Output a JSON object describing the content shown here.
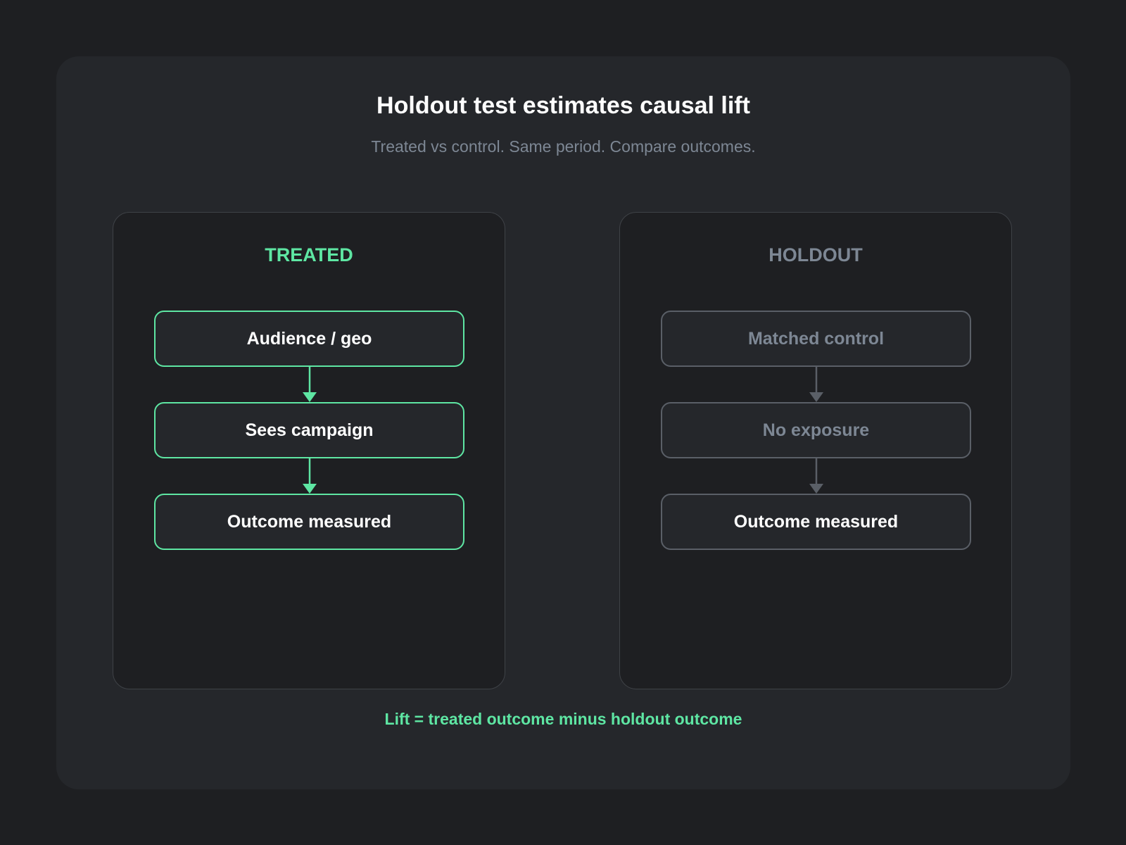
{
  "title": "Holdout test estimates causal lift",
  "subtitle": "Treated vs control. Same period. Compare outcomes.",
  "colors": {
    "accent": "#5ee6a3",
    "muted": "#7d8794",
    "background": "#1e1f22",
    "card": "#25272b"
  },
  "treated": {
    "heading": "TREATED",
    "steps": [
      "Audience / geo",
      "Sees campaign",
      "Outcome measured"
    ]
  },
  "holdout": {
    "heading": "HOLDOUT",
    "steps": [
      "Matched control",
      "No exposure",
      "Outcome measured"
    ]
  },
  "footer": "Lift = treated outcome minus holdout outcome"
}
